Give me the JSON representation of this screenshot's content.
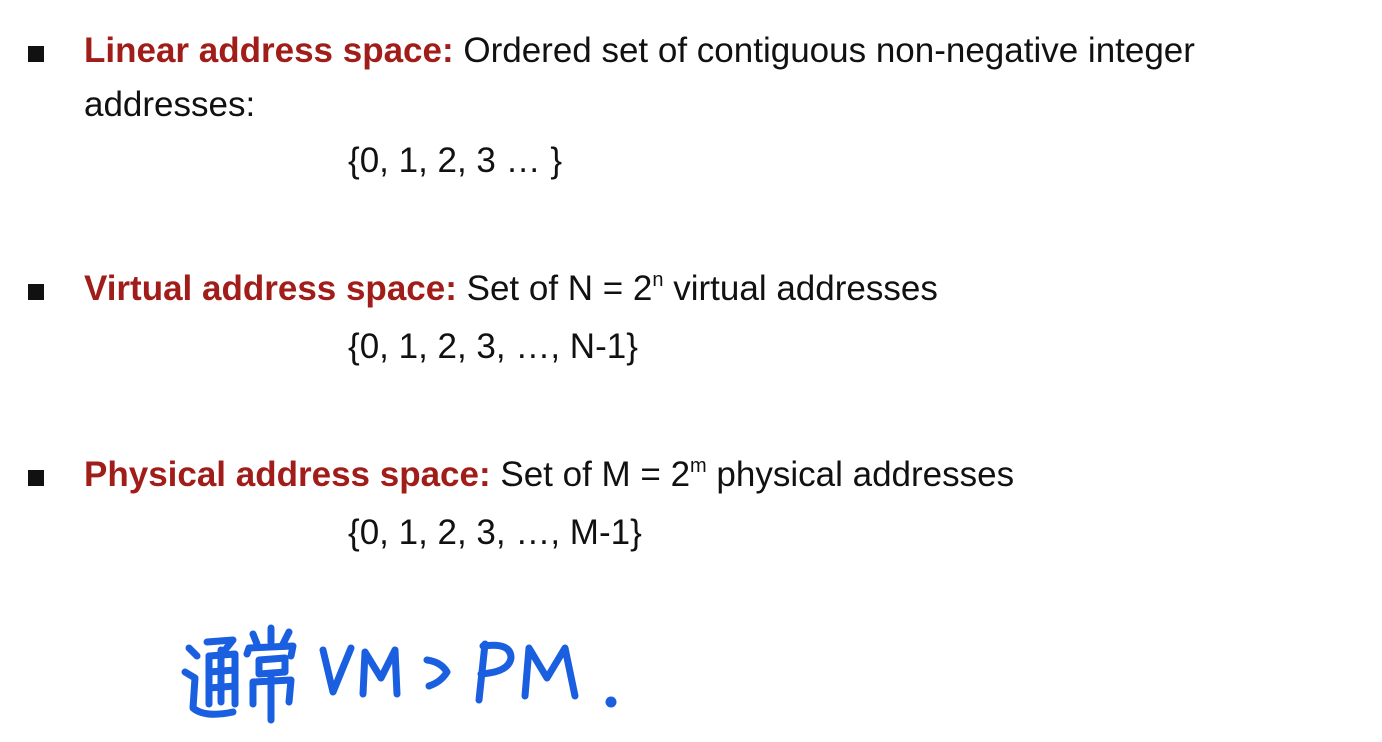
{
  "items": [
    {
      "term": "Linear address space:",
      "text_before": " Ordered set of contiguous non-negative integer addresses:",
      "sup": "",
      "text_after": "",
      "set": "{0, 1, 2, 3 … }"
    },
    {
      "term": "Virtual address space:",
      "text_before": " Set of N = 2",
      "sup": "n",
      "text_after": " virtual addresses",
      "set": "{0, 1, 2, 3, …, N-1}"
    },
    {
      "term": "Physical address space:",
      "text_before": " Set of M = 2",
      "sup": "m",
      "text_after": " physical addresses",
      "set": "{0, 1, 2, 3, …, M-1}"
    }
  ],
  "annotation": {
    "text": "通常 VM > PM.",
    "color": "#1a5fe0"
  },
  "colors": {
    "term": "#a11d1a",
    "bullet": "#111111",
    "body": "#111111"
  }
}
